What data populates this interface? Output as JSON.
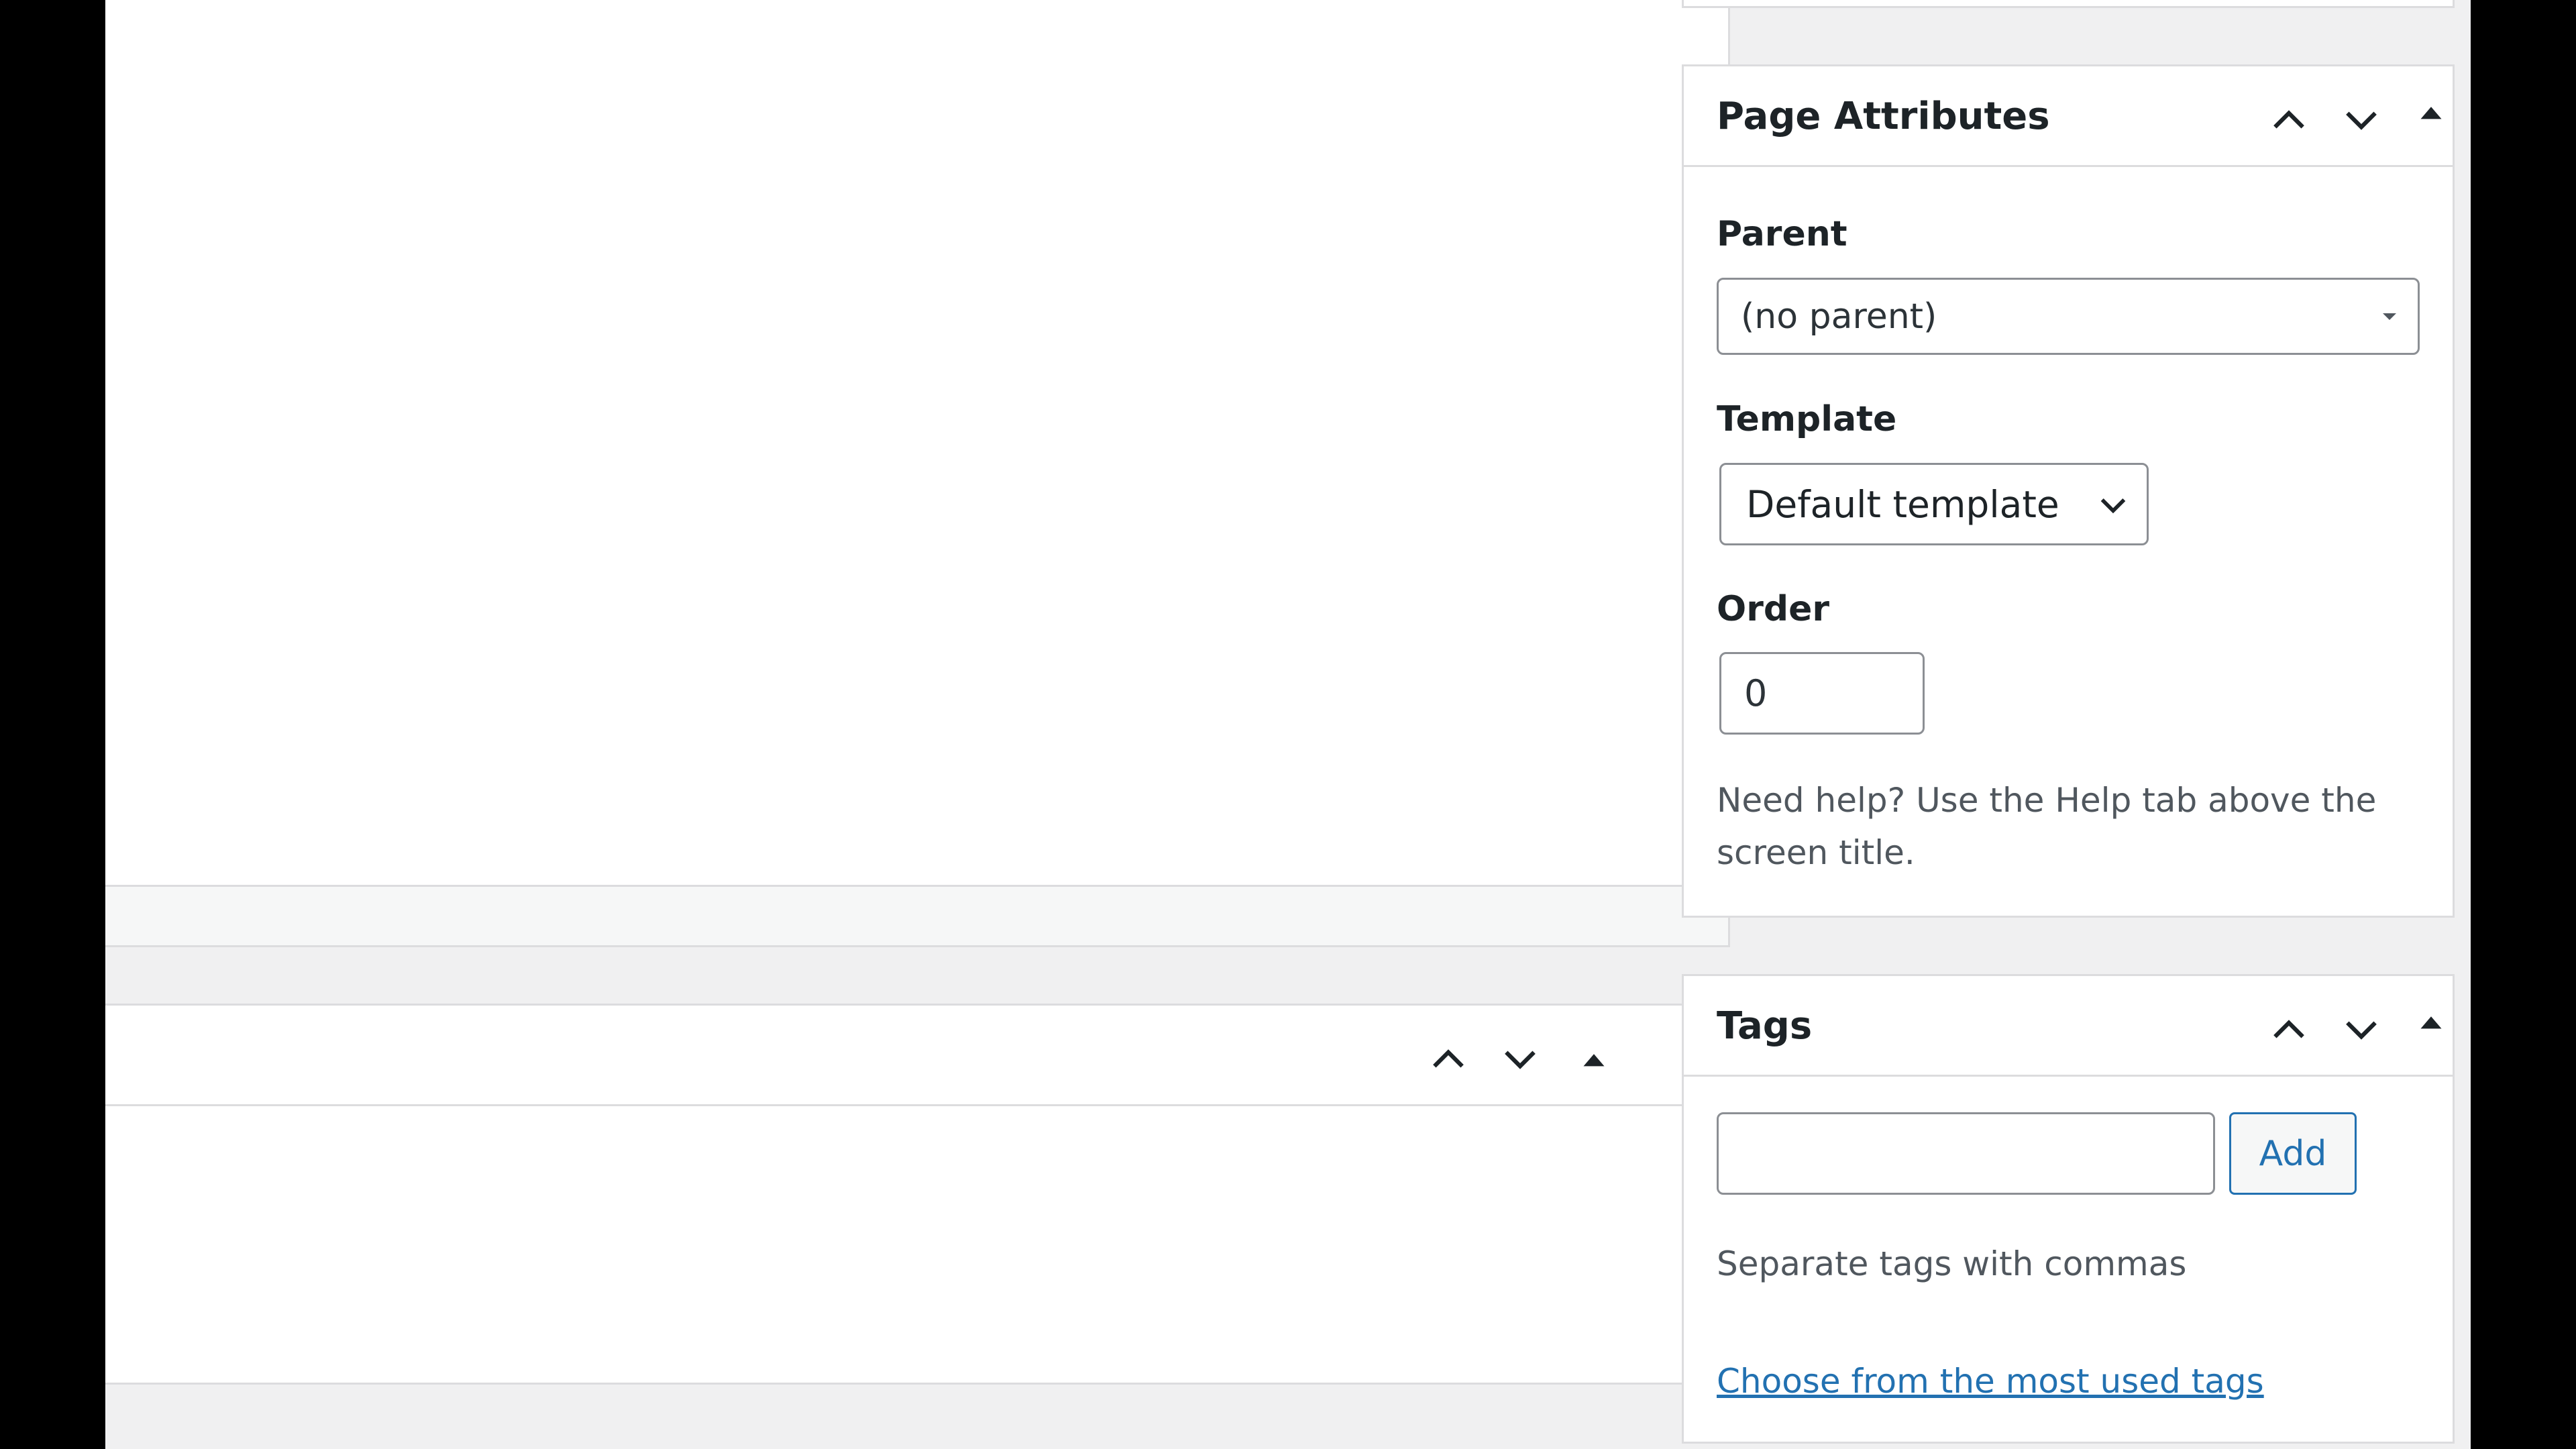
{
  "page_attributes": {
    "title": "Page Attributes",
    "parent_label": "Parent",
    "parent_value": "(no parent)",
    "template_label": "Template",
    "template_value": "Default template",
    "order_label": "Order",
    "order_value": "0",
    "help_line1": "Need help? Use the Help tab above the",
    "help_line2": "screen title."
  },
  "tags": {
    "title": "Tags",
    "input_value": "",
    "add_label": "Add",
    "hint": "Separate tags with commas",
    "choose_link": "Choose from the most used tags"
  },
  "icons": {
    "move_up": "chevron-up-icon",
    "move_down": "chevron-down-icon",
    "toggle": "triangle-up-icon",
    "select_arrow": "caret-down-icon"
  },
  "colors": {
    "link": "#2271b1",
    "border": "#dcdcde",
    "background": "#f0f0f1"
  }
}
